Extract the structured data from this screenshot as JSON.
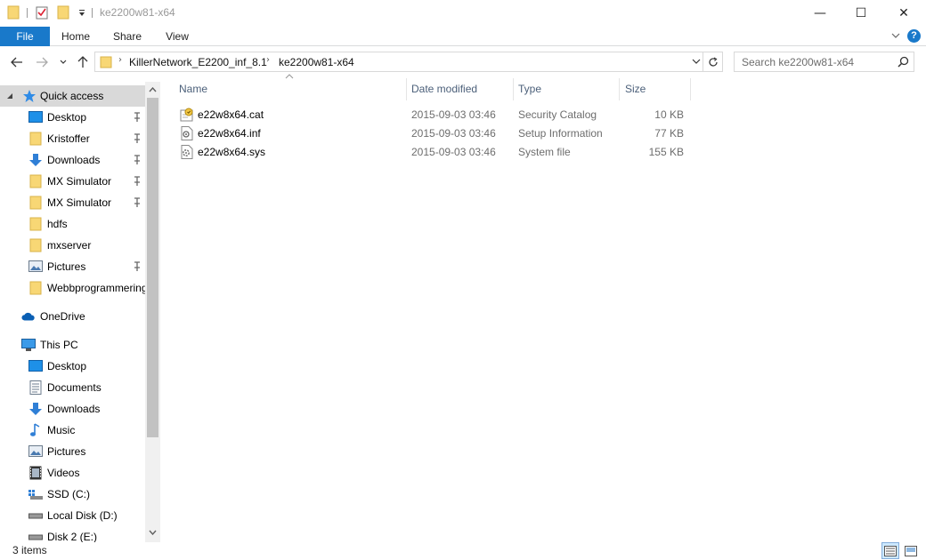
{
  "window": {
    "title": "ke2200w81-x64",
    "minimize_glyph": "—",
    "maximize_glyph": "☐",
    "close_glyph": "✕"
  },
  "ribbon": {
    "tabs": [
      "File",
      "Home",
      "Share",
      "View"
    ],
    "help": "?"
  },
  "address": {
    "crumbs": [
      "KillerNetwork_E2200_inf_8.1",
      "ke2200w81-x64"
    ],
    "search_placeholder": "Search ke2200w81-x64"
  },
  "nav": {
    "quick_access": "Quick access",
    "quick_items": [
      {
        "label": "Desktop",
        "icon": "desktop-icon",
        "pinned": true
      },
      {
        "label": "Kristoffer",
        "icon": "folder-icon",
        "pinned": true
      },
      {
        "label": "Downloads",
        "icon": "downloads-icon",
        "pinned": true
      },
      {
        "label": "MX Simulator",
        "icon": "folder-icon",
        "pinned": true
      },
      {
        "label": "MX Simulator",
        "icon": "folder-icon",
        "pinned": true
      },
      {
        "label": "hdfs",
        "icon": "folder-icon",
        "pinned": false
      },
      {
        "label": "mxserver",
        "icon": "folder-icon",
        "pinned": false
      },
      {
        "label": "Pictures",
        "icon": "pictures-icon",
        "pinned": true
      },
      {
        "label": "Webbprogrammering",
        "icon": "folder-icon",
        "pinned": false
      }
    ],
    "onedrive": "OneDrive",
    "this_pc": "This PC",
    "pc_items": [
      {
        "label": "Desktop",
        "icon": "desktop-icon"
      },
      {
        "label": "Documents",
        "icon": "documents-icon"
      },
      {
        "label": "Downloads",
        "icon": "downloads-icon"
      },
      {
        "label": "Music",
        "icon": "music-icon"
      },
      {
        "label": "Pictures",
        "icon": "pictures-icon"
      },
      {
        "label": "Videos",
        "icon": "videos-icon"
      },
      {
        "label": "SSD (C:)",
        "icon": "ssd-drive-icon"
      },
      {
        "label": "Local Disk (D:)",
        "icon": "disk-drive-icon"
      },
      {
        "label": "Disk 2 (E:)",
        "icon": "disk-drive-icon"
      }
    ]
  },
  "columns": {
    "name": "Name",
    "date": "Date modified",
    "type": "Type",
    "size": "Size"
  },
  "files": [
    {
      "name": "e22w8x64.cat",
      "date": "2015-09-03 03:46",
      "type": "Security Catalog",
      "size": "10 KB",
      "icon": "security-catalog-icon"
    },
    {
      "name": "e22w8x64.inf",
      "date": "2015-09-03 03:46",
      "type": "Setup Information",
      "size": "77 KB",
      "icon": "setup-info-icon"
    },
    {
      "name": "e22w8x64.sys",
      "date": "2015-09-03 03:46",
      "type": "System file",
      "size": "155 KB",
      "icon": "system-file-icon"
    }
  ],
  "status": {
    "item_count": "3 items"
  },
  "colors": {
    "accent": "#1979ca",
    "selection": "#d9d9d9",
    "folder": "#f8d775",
    "header_text": "#4c607a"
  }
}
